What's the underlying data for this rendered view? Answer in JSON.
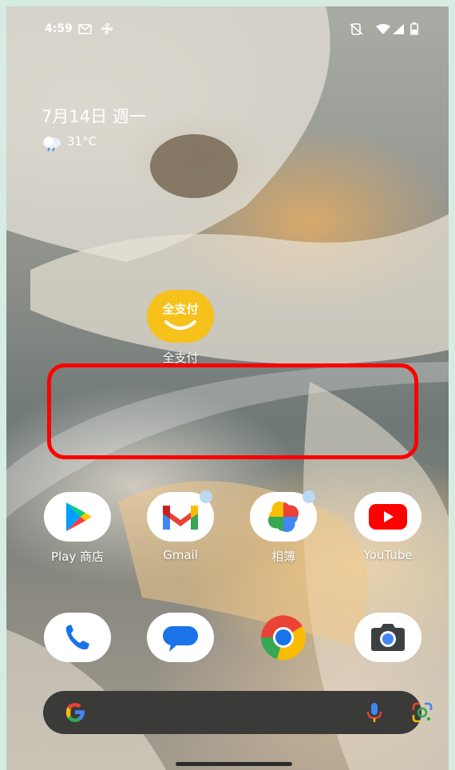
{
  "status_bar": {
    "time": "4:59",
    "icons": [
      "gmail-notification-icon",
      "fan-icon",
      "no-sim-icon",
      "wifi-icon",
      "signal-icon",
      "battery-icon"
    ]
  },
  "widget": {
    "date": "7月14日 週一",
    "temperature": "31°C",
    "weather_icon": "cloud-rain-icon"
  },
  "apps": {
    "quanzhifu": {
      "label": "全支付",
      "icon_text": "全支付"
    },
    "play": {
      "label": "Play 商店"
    },
    "gmail": {
      "label": "Gmail"
    },
    "photos": {
      "label": "相簿"
    },
    "youtube": {
      "label": "YouTube"
    }
  },
  "dock": [
    "phone-icon",
    "messages-icon",
    "chrome-icon",
    "camera-icon"
  ],
  "colors": {
    "highlight": "#ff0000",
    "quanzhifu_bg": "#f7c11b",
    "searchbar_bg": "#3a3b38"
  }
}
